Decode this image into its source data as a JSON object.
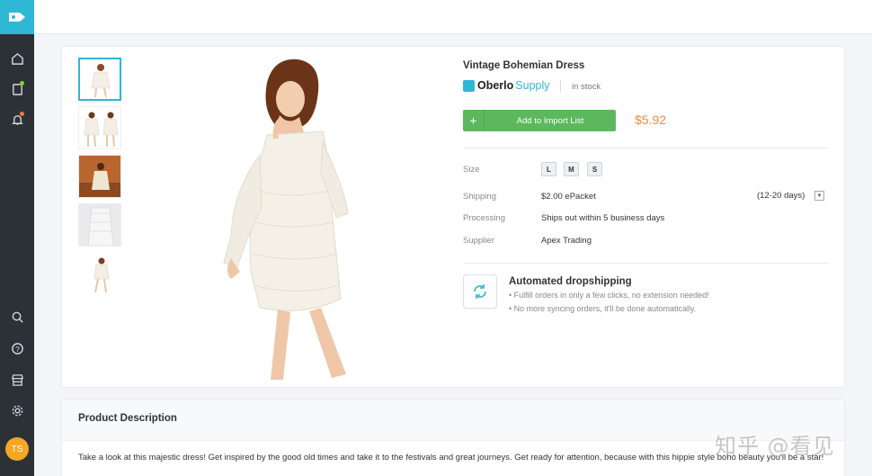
{
  "sidebar": {
    "icons": [
      "tag-logo-icon",
      "home-icon",
      "orders-icon",
      "bell-icon",
      "search-icon",
      "help-icon",
      "store-icon",
      "gear-icon"
    ],
    "avatar_initials": "TS"
  },
  "product": {
    "title": "Vintage Bohemian Dress",
    "supplier_brand": "Oberlo",
    "supplier_brand_suffix": "Supply",
    "stock": "in stock",
    "add_button": "Add to Import List",
    "price": "$5.92",
    "size_label": "Size",
    "sizes": [
      "L",
      "M",
      "S"
    ],
    "shipping_label": "Shipping",
    "shipping_value": "$2.00 ePacket",
    "shipping_days": "(12-20 days)",
    "processing_label": "Processing",
    "processing_value": "Ships out within 5 business days",
    "supplier_label": "Supplier",
    "supplier_value": "Apex Trading"
  },
  "automation": {
    "title": "Automated dropshipping",
    "line1": "• Fulfill orders in only a few clicks, no extension needed!",
    "line2": "• No more syncing orders, it'll be done automatically."
  },
  "description": {
    "heading": "Product Description",
    "text": "Take a look at this majestic dress! Get inspired by the good old times and take it to the festivals and great journeys. Get ready for attention, because with this hippie style boho beauty you'll be a star!"
  },
  "watermark": "知乎 @看见",
  "colors": {
    "accent": "#2fb7d6",
    "button": "#5cb85c",
    "price": "#f28a3c",
    "sidebar": "#2b3137"
  }
}
